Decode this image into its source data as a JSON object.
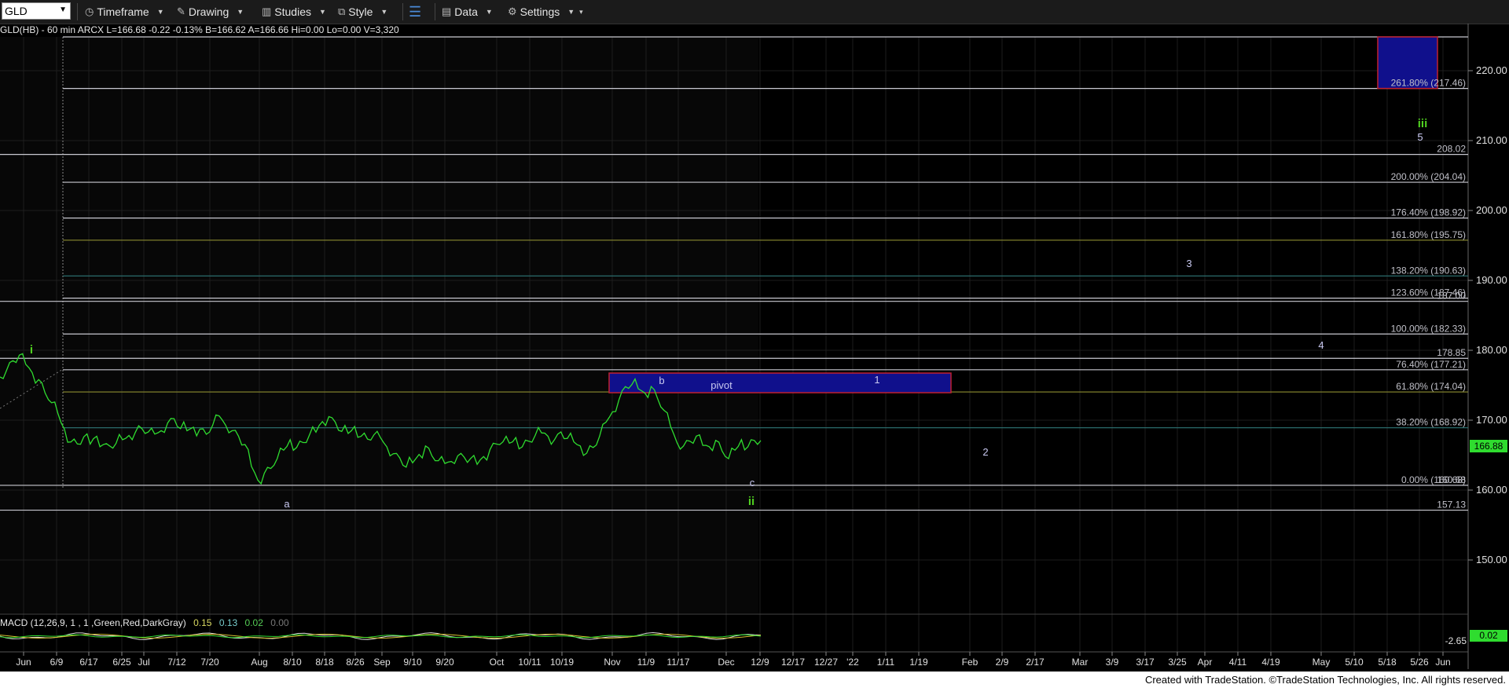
{
  "toolbar": {
    "symbol": "GLD",
    "timeframe_label": "Timeframe",
    "drawing_label": "Drawing",
    "studies_label": "Studies",
    "style_label": "Style",
    "data_label": "Data",
    "settings_label": "Settings"
  },
  "info": {
    "text": "GLD(HB) - 60 min  ARCX  L=166.68  -0.22  -0.13%  B=166.62  A=166.66  Hi=0.00  Lo=0.00  V=3,320"
  },
  "macd": {
    "label": "MACD (12,26,9, 1 , 1 ,Green,Red,DarkGray)",
    "v1": "0.15",
    "v2": "0.13",
    "v3": "0.02",
    "v4": "0.00",
    "axis_value": "-2.65",
    "last_badge": "0.02"
  },
  "footer": {
    "text": "Created with TradeStation. ©TradeStation Technologies, Inc. All rights reserved."
  },
  "colors": {
    "price": "#2fdc2f",
    "hline": "#c8c8d0",
    "fib_yellow": "#8c8c30",
    "fib_teal": "#2a6b6b",
    "box_fill": "#10108c",
    "box_border": "#c02030",
    "wave_green": "#50d020",
    "wave_blue": "#c8c8f0",
    "last_badge": "#2fdc2f"
  },
  "chart_data": {
    "type": "line",
    "title": "",
    "ylim": [
      140,
      227
    ],
    "y_ticks": [
      150,
      160,
      170,
      180,
      190,
      200,
      210,
      220
    ],
    "x_tick_labels": [
      "Jun",
      "6/9",
      "6/17",
      "6/25",
      "Jul",
      "7/12",
      "7/20",
      "Aug",
      "8/10",
      "8/18",
      "8/26",
      "Sep",
      "9/10",
      "9/20",
      "Oct",
      "10/11",
      "10/19",
      "Nov",
      "11/9",
      "11/17",
      "Dec",
      "12/9",
      "12/17",
      "12/27",
      "'22",
      "1/11",
      "1/19",
      "Feb",
      "2/9",
      "2/17",
      "Mar",
      "3/9",
      "3/17",
      "3/25",
      "Apr",
      "4/11",
      "4/19",
      "May",
      "5/10",
      "5/18",
      "5/26",
      "Jun"
    ],
    "last_price": "166.88",
    "series": [
      {
        "values": [
          176.5,
          177.2,
          178.4,
          179.0,
          178.2,
          176.8,
          175.6,
          174.2,
          172.6,
          170.8,
          168.4,
          167.1,
          166.6,
          167.4,
          166.9,
          167.8,
          166.4,
          166.0,
          166.9,
          167.2,
          167.6,
          168.6,
          168.9,
          168.2,
          167.7,
          168.7,
          169.6,
          170.0,
          169.1,
          168.6,
          168.9,
          168.4,
          168.2,
          169.3,
          170.4,
          169.6,
          168.6,
          167.6,
          166.2,
          163.6,
          161.4,
          162.2,
          163.4,
          164.6,
          165.6,
          166.9,
          166.3,
          166.8,
          167.7,
          168.6,
          169.9,
          170.4,
          169.4,
          168.6,
          168.1,
          168.9,
          168.0,
          167.4,
          167.8,
          167.2,
          166.4,
          165.2,
          164.4,
          163.6,
          164.0,
          165.0,
          166.0,
          165.1,
          164.2,
          163.6,
          164.4,
          165.0,
          164.6,
          164.2,
          163.9,
          164.8,
          165.6,
          166.9,
          167.0,
          166.6,
          167.2,
          166.4,
          167.0,
          167.6,
          168.5,
          167.8,
          167.1,
          168.0,
          167.6,
          166.9,
          166.1,
          165.6,
          166.2,
          167.6,
          169.4,
          171.4,
          172.9,
          174.6,
          175.4,
          174.6,
          173.8,
          174.5,
          173.3,
          171.4,
          168.9,
          167.1,
          166.4,
          166.9,
          167.4,
          166.6,
          166.2,
          166.9,
          165.9,
          164.6,
          165.6,
          166.9,
          166.4,
          167.1,
          166.88
        ]
      }
    ],
    "horizontal_levels": [
      {
        "label": "261.80% (217.46)",
        "value": 217.46
      },
      {
        "label": "208.02",
        "value": 208.02
      },
      {
        "label": "200.00% (204.04)",
        "value": 204.04
      },
      {
        "label": "176.40% (198.92)",
        "value": 198.92
      },
      {
        "label": "161.80% (195.75)",
        "value": 195.75
      },
      {
        "label": "138.20% (190.63)",
        "value": 190.63
      },
      {
        "label": "123.60% (187.46)",
        "value": 187.46
      },
      {
        "label": "187.00",
        "value": 187.0
      },
      {
        "label": "100.00% (182.33)",
        "value": 182.33
      },
      {
        "label": "178.85",
        "value": 178.85
      },
      {
        "label": "76.40% (177.21)",
        "value": 177.21
      },
      {
        "label": "61.80% (174.04)",
        "value": 174.04
      },
      {
        "label": "38.20% (168.92)",
        "value": 168.92
      },
      {
        "label": "0.00% (160.68)",
        "value": 160.68
      },
      {
        "label": "160.68",
        "value": 160.68
      },
      {
        "label": "157.13",
        "value": 157.13
      }
    ],
    "annotations": [
      {
        "text": "i",
        "group": "green"
      },
      {
        "text": "a",
        "group": "blue"
      },
      {
        "text": "b",
        "group": "blue"
      },
      {
        "text": "pivot",
        "group": "blue"
      },
      {
        "text": "c",
        "group": "blue"
      },
      {
        "text": "ii",
        "group": "green"
      },
      {
        "text": "1",
        "group": "blue"
      },
      {
        "text": "2",
        "group": "blue"
      },
      {
        "text": "3",
        "group": "blue"
      },
      {
        "text": "4",
        "group": "blue"
      },
      {
        "text": "5",
        "group": "blue"
      },
      {
        "text": "iii",
        "group": "green"
      }
    ]
  }
}
